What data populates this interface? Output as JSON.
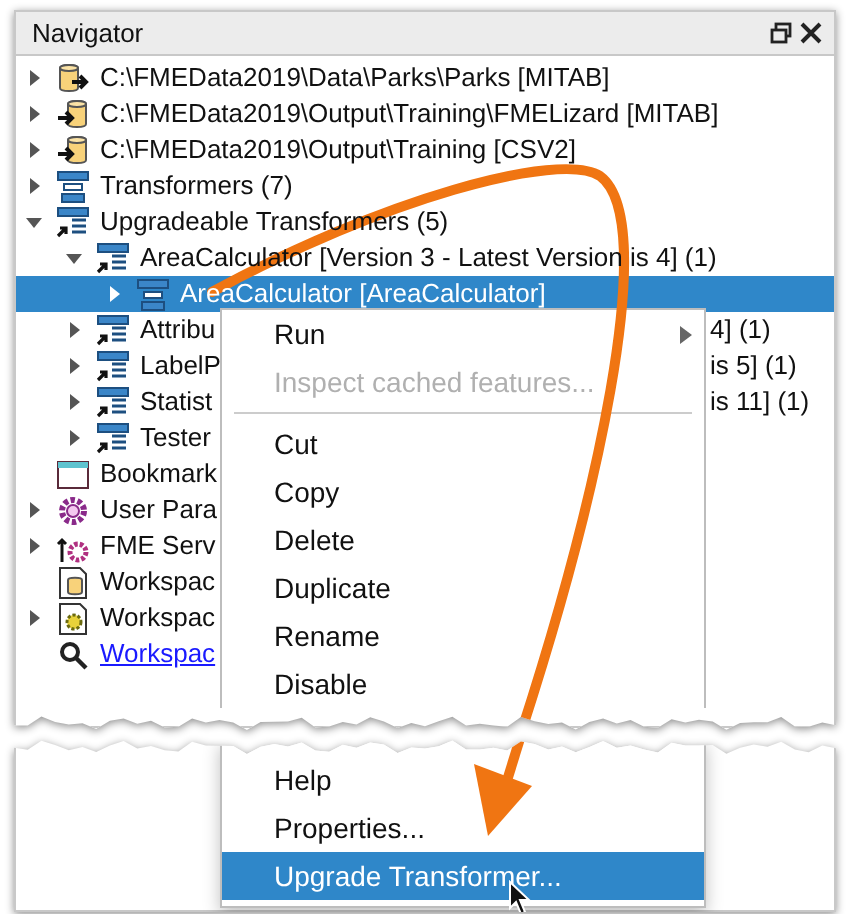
{
  "panel": {
    "title": "Navigator"
  },
  "tree": [
    {
      "label": "C:\\FMEData2019\\Data\\Parks\\Parks [MITAB]",
      "kind": "reader",
      "has_children": true,
      "expanded": false,
      "selected": false
    },
    {
      "label": "C:\\FMEData2019\\Output\\Training\\FMELizard [MITAB]",
      "kind": "writer",
      "has_children": true,
      "expanded": false,
      "selected": false
    },
    {
      "label": "C:\\FMEData2019\\Output\\Training [CSV2]",
      "kind": "writer",
      "has_children": true,
      "expanded": false,
      "selected": false
    },
    {
      "label": "Transformers (7)",
      "kind": "transformers",
      "has_children": true,
      "expanded": false,
      "selected": false
    },
    {
      "label": "Upgradeable Transformers (5)",
      "kind": "upgradeable",
      "has_children": true,
      "expanded": true,
      "selected": false,
      "children": [
        {
          "label": "AreaCalculator [Version 3 - Latest Version is 4] (1)",
          "kind": "upgradeable",
          "has_children": true,
          "expanded": true,
          "selected": false,
          "children": [
            {
              "label": "AreaCalculator [AreaCalculator]",
              "kind": "transformers",
              "has_children": true,
              "expanded": false,
              "selected": true
            }
          ]
        },
        {
          "label": "Attribu",
          "label_right": "4] (1)",
          "kind": "upgradeable",
          "has_children": true,
          "expanded": false,
          "selected": false
        },
        {
          "label": "LabelP",
          "label_right": "is 5] (1)",
          "kind": "upgradeable",
          "has_children": true,
          "expanded": false,
          "selected": false
        },
        {
          "label": "Statist",
          "label_right": "is 11] (1)",
          "kind": "upgradeable",
          "has_children": true,
          "expanded": false,
          "selected": false
        },
        {
          "label": "Tester",
          "kind": "upgradeable",
          "has_children": true,
          "expanded": false,
          "selected": false
        }
      ]
    },
    {
      "label": "Bookmark",
      "kind": "bookmark",
      "has_children": false,
      "selected": false
    },
    {
      "label": "User Para",
      "kind": "params",
      "has_children": true,
      "expanded": false,
      "selected": false
    },
    {
      "label": "FME Serv",
      "kind": "server",
      "has_children": true,
      "expanded": false,
      "selected": false
    },
    {
      "label": "Workspac",
      "kind": "resources",
      "has_children": false,
      "selected": false
    },
    {
      "label": "Workspac",
      "kind": "settings",
      "has_children": true,
      "expanded": false,
      "selected": false
    },
    {
      "label": "Workspac",
      "kind": "search",
      "has_children": false,
      "selected": false
    }
  ],
  "context_menu": {
    "upper_items": [
      {
        "kind": "item",
        "label": "Run",
        "disabled": false,
        "selected": false,
        "submenu": true
      },
      {
        "kind": "item",
        "label": "Inspect cached features...",
        "disabled": true,
        "selected": false,
        "submenu": false
      },
      {
        "kind": "separator"
      },
      {
        "kind": "item",
        "label": "Cut",
        "disabled": false,
        "selected": false,
        "submenu": false
      },
      {
        "kind": "item",
        "label": "Copy",
        "disabled": false,
        "selected": false,
        "submenu": false
      },
      {
        "kind": "item",
        "label": "Delete",
        "disabled": false,
        "selected": false,
        "submenu": false
      },
      {
        "kind": "item",
        "label": "Duplicate",
        "disabled": false,
        "selected": false,
        "submenu": false
      },
      {
        "kind": "item",
        "label": "Rename",
        "disabled": false,
        "selected": false,
        "submenu": false
      },
      {
        "kind": "item",
        "label": "Disable",
        "disabled": false,
        "selected": false,
        "submenu": false
      }
    ],
    "lower_items": [
      {
        "kind": "item",
        "label": "Help",
        "disabled": false,
        "selected": false,
        "submenu": false
      },
      {
        "kind": "item",
        "label": "Properties...",
        "disabled": false,
        "selected": false,
        "submenu": false
      },
      {
        "kind": "item",
        "label": "Upgrade Transformer...",
        "disabled": false,
        "selected": true,
        "submenu": false
      }
    ]
  }
}
